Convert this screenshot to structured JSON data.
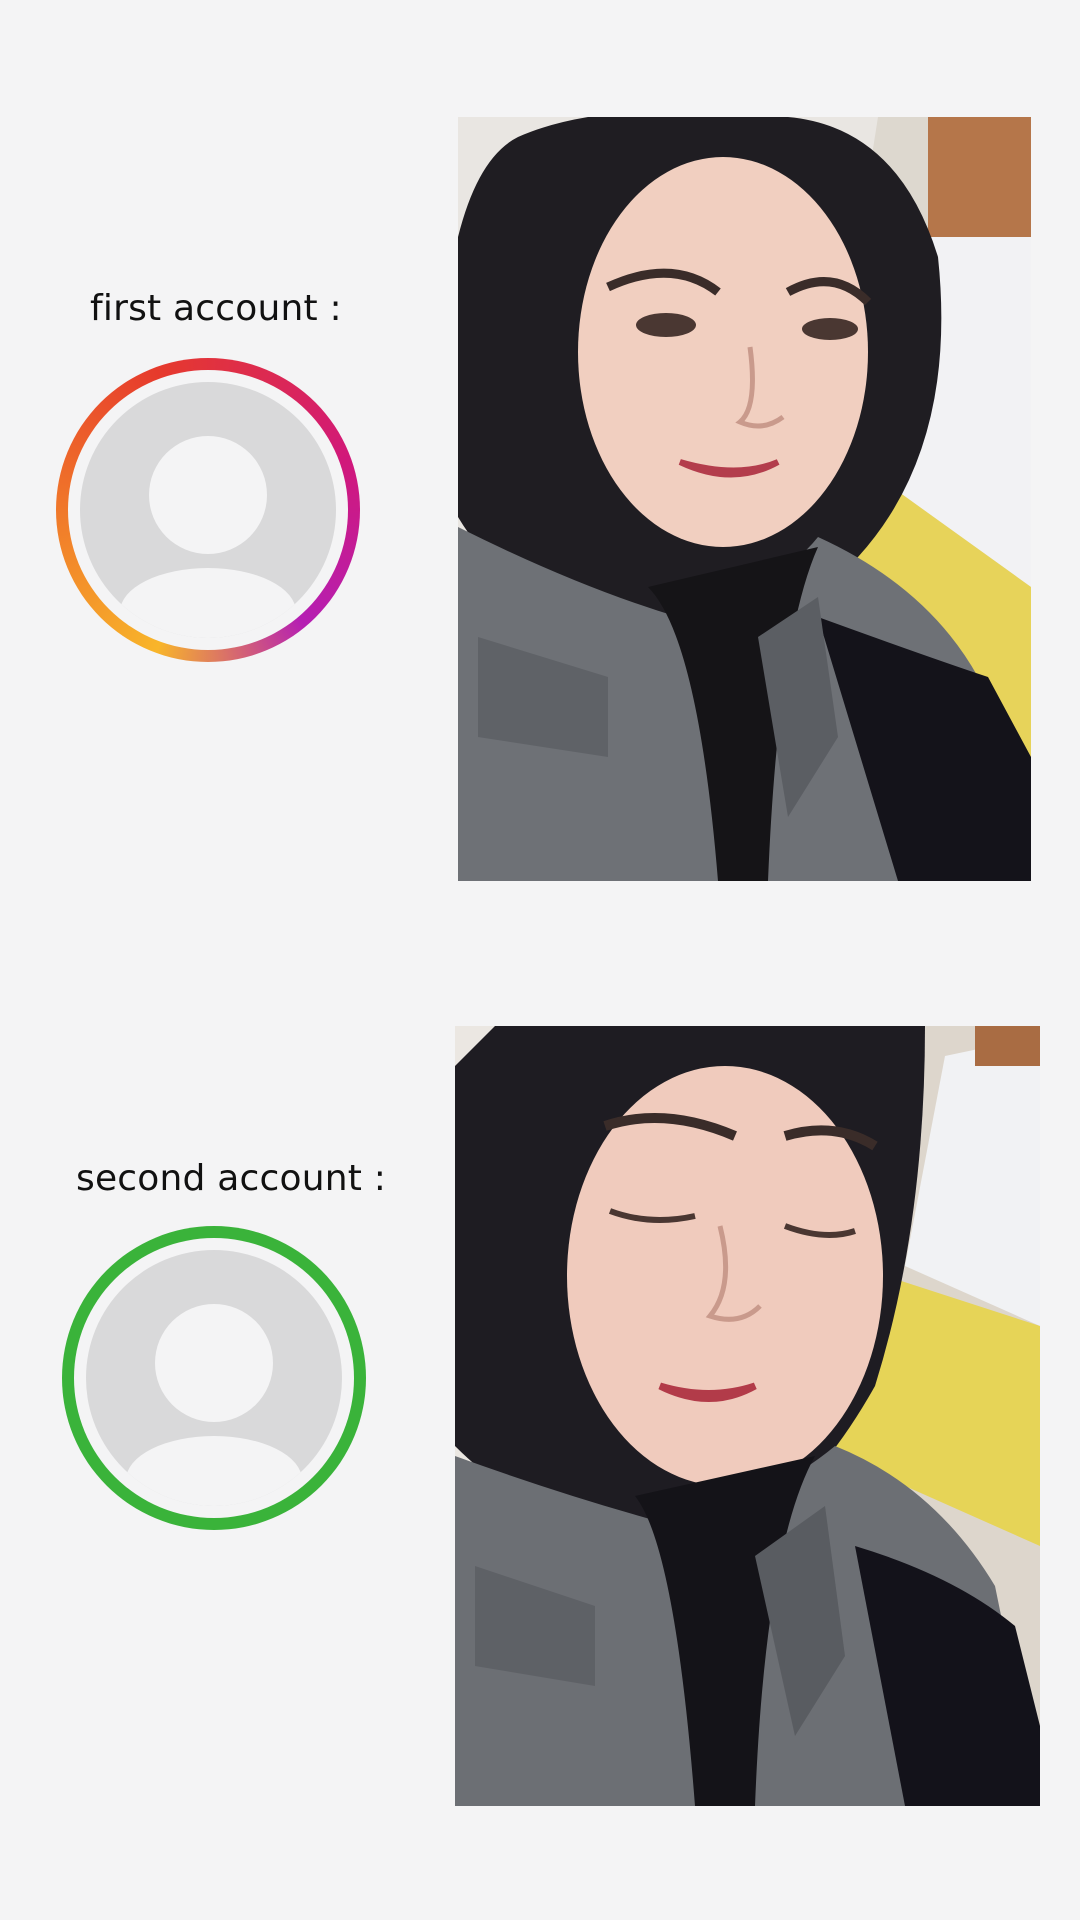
{
  "first": {
    "label": "first account :"
  },
  "second": {
    "label": "second account :"
  },
  "colors": {
    "background": "#f4f4f5",
    "first_ring_gradient": [
      "#f8b52a",
      "#e63a2c",
      "#d1187a",
      "#b51fb3"
    ],
    "second_ring": "#3ab33a"
  }
}
